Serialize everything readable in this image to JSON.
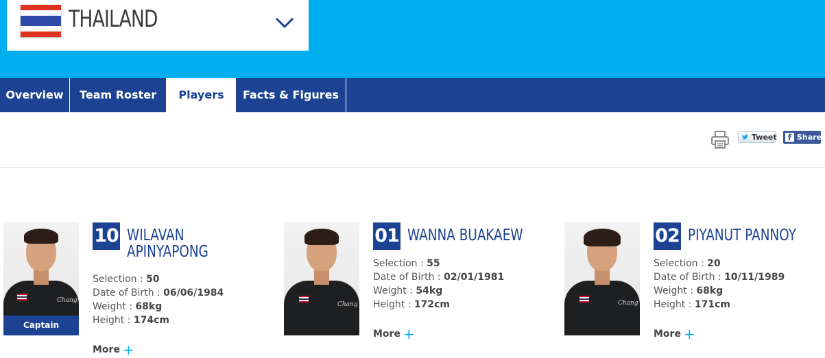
{
  "team": {
    "name": "THAILAND"
  },
  "nav": {
    "tabs": [
      {
        "label": "Overview"
      },
      {
        "label": "Team Roster"
      },
      {
        "label": "Players"
      },
      {
        "label": "Facts & Figures"
      }
    ]
  },
  "share": {
    "tweet_label": "Tweet",
    "share_label": "Share"
  },
  "labels": {
    "selection": "Selection :",
    "dob": "Date of Birth :",
    "weight": "Weight :",
    "height": "Height :",
    "more": "More",
    "captain": "Captain"
  },
  "players": [
    {
      "number": "10",
      "name_line1": "WILAVAN",
      "name_line2": "APINYAPONG",
      "selection": "50",
      "dob": "06/06/1984",
      "weight": "68kg",
      "height": "174cm"
    },
    {
      "number": "01",
      "name_line1": "WANNA BUAKAEW",
      "name_line2": "",
      "selection": "55",
      "dob": "02/01/1981",
      "weight": "54kg",
      "height": "172cm"
    },
    {
      "number": "02",
      "name_line1": "PIYANUT PANNOY",
      "name_line2": "",
      "selection": "20",
      "dob": "10/11/1989",
      "weight": "68kg",
      "height": "171cm"
    }
  ],
  "colors": {
    "header": "#00adef",
    "nav": "#1b4293",
    "accent": "#00adef"
  }
}
